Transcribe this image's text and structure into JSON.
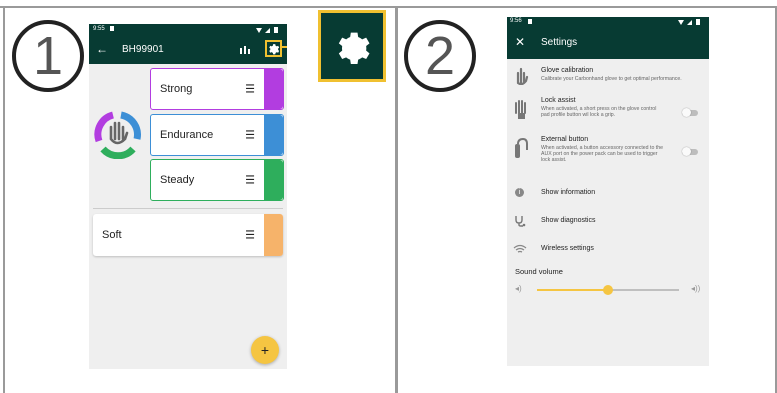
{
  "steps": {
    "one": "1",
    "two": "2"
  },
  "phone1": {
    "status_time": "9:55",
    "title": "BH99901",
    "modes": [
      {
        "label": "Strong",
        "color": "#b23de0"
      },
      {
        "label": "Endurance",
        "color": "#3d8fd6"
      },
      {
        "label": "Steady",
        "color": "#2eae5c"
      }
    ],
    "soft": {
      "label": "Soft",
      "color": "#f6b36a"
    },
    "fab_label": "+",
    "accent": "#073b33",
    "highlight": "#f0c030"
  },
  "phone2": {
    "status_time": "9:56",
    "title": "Settings",
    "glove_calibration": {
      "title": "Glove calibration",
      "desc": "Calibrate your Carbonhand glove to get optimal performance."
    },
    "lock_assist": {
      "title": "Lock assist",
      "desc": "When activated, a short press on the glove control pad profile button wil lock a grip."
    },
    "external_button": {
      "title": "External button",
      "desc": "When activated, a button accessory connected to the AUX port on the power pack can be used to trigger lock assist."
    },
    "show_information": "Show information",
    "show_diagnostics": "Show diagnostics",
    "wireless_settings": "Wireless settings",
    "sound_volume": {
      "label": "Sound volume",
      "level": 0.5
    }
  }
}
